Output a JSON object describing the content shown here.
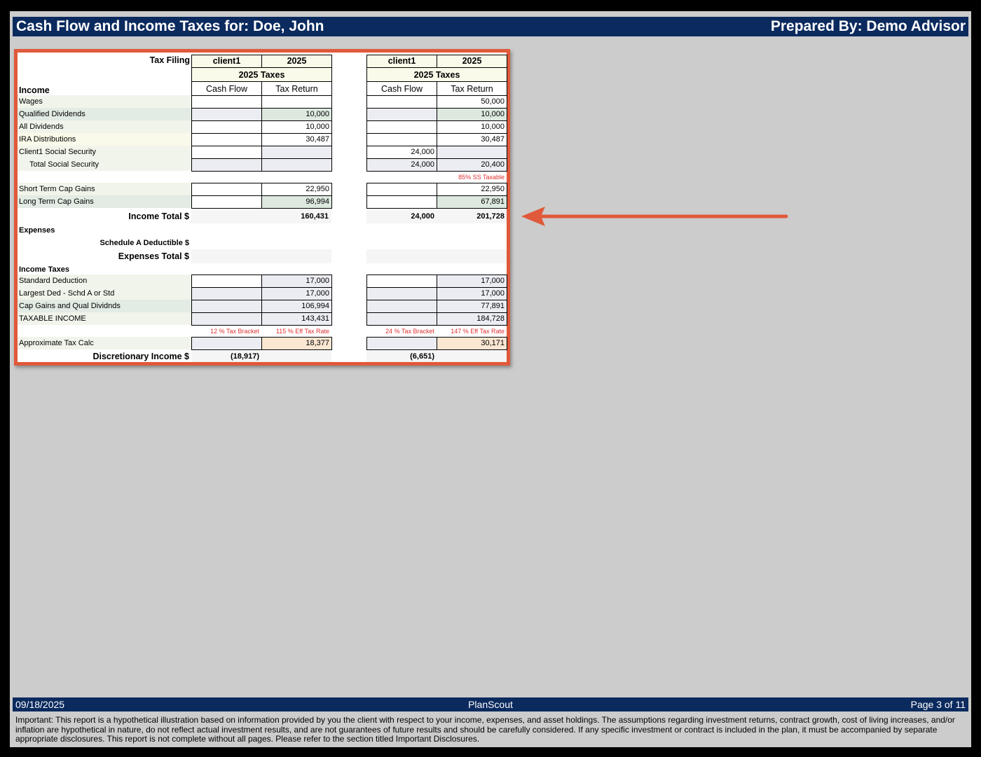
{
  "header": {
    "title": "Cash Flow and Income Taxes for: Doe, John",
    "prepared_by": "Prepared By: Demo Advisor"
  },
  "table": {
    "tax_filing_label": "Tax Filing",
    "col_client": "client1",
    "col_year": "2025",
    "taxes_header": "2025 Taxes",
    "col_cash_flow": "Cash Flow",
    "col_tax_return": "Tax Return",
    "income_heading": "Income",
    "rows": {
      "wages": {
        "label": "Wages",
        "a_tr": "",
        "b_cf": "",
        "b_tr": "50,000"
      },
      "qual_div": {
        "label": "Qualified Dividends",
        "a_tr": "10,000",
        "b_tr": "10,000"
      },
      "all_div": {
        "label": "All Dividends",
        "a_tr": "10,000",
        "b_tr": "10,000"
      },
      "ira": {
        "label": "IRA Distributions",
        "a_tr": "30,487",
        "b_tr": "30,487"
      },
      "c1ss": {
        "label": "Client1 Social Security",
        "b_cf": "24,000"
      },
      "totss": {
        "label": "Total Social Security",
        "b_cf": "24,000",
        "b_tr": "20,400"
      },
      "ss_note": "85% SS Taxable",
      "stcg": {
        "label": "Short Term Cap Gains",
        "a_tr": "22,950",
        "b_tr": "22,950"
      },
      "ltcg": {
        "label": "Long Term Cap Gains",
        "a_tr": "96,994",
        "b_tr": "67,891"
      }
    },
    "income_total": {
      "label": "Income Total $",
      "a_tr": "160,431",
      "b_cf": "24,000",
      "b_tr": "201,728"
    },
    "expenses_heading": "Expenses",
    "sched_a": "Schedule A Deductible $",
    "expenses_total": "Expenses Total $",
    "income_taxes_heading": "Income Taxes",
    "tax_rows": {
      "std": {
        "label": "Standard Deduction",
        "a_tr": "17,000",
        "b_tr": "17,000"
      },
      "largest": {
        "label": "Largest Ded - Schd A or Std",
        "a_tr": "17,000",
        "b_tr": "17,000"
      },
      "capq": {
        "label": "Cap Gains and Qual Dividnds",
        "a_tr": "106,994",
        "b_tr": "77,891"
      },
      "taxable": {
        "label": "TAXABLE INCOME",
        "a_tr": "143,431",
        "b_tr": "184,728"
      }
    },
    "notes": {
      "a_bracket": "12 % Tax Bracket",
      "a_eff": "115 % Eff Tax Rate",
      "b_bracket": "24 % Tax Bracket",
      "b_eff": "147 % Eff Tax Rate"
    },
    "approx": {
      "label": "Approximate Tax Calc",
      "a_tr": "18,377",
      "b_tr": "30,171"
    },
    "discretionary": {
      "label": "Discretionary Income $",
      "a_cf": "(18,917)",
      "b_cf": "(6,651)"
    }
  },
  "footer": {
    "date": "09/18/2025",
    "brand": "PlanScout",
    "page": "Page 3 of 11",
    "disclaimer": "Important:  This report is a hypothetical illustration based on information provided by you the client with respect to your income, expenses, and asset holdings. The assumptions regarding investment returns, contract growth, cost of living increases, and/or inflation are hypothetical in nature, do not reflect actual investment results, and are not guarantees of future results and should be carefully considered. If any specific investment or contract is included in the plan, it must be accompanied by separate appropriate disclosures. This report is not complete without all pages. Please refer to the section titled Important Disclosures."
  },
  "colors": {
    "accent_border": "#e0593a",
    "header_bg": "#0b2a5e",
    "note_red": "#e03030"
  }
}
